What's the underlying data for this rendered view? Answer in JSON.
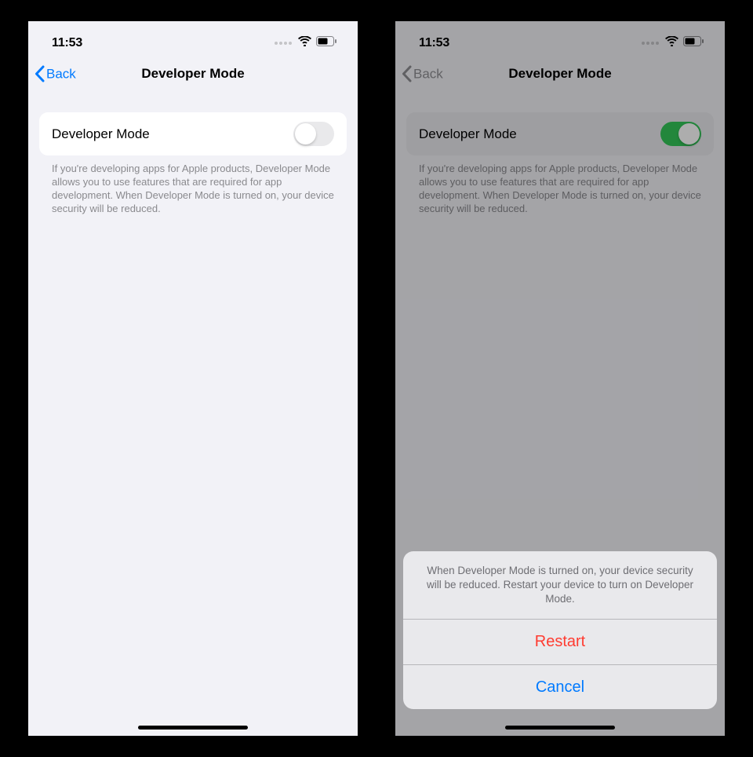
{
  "status": {
    "time": "11:53"
  },
  "screens": {
    "left": {
      "back": "Back",
      "title": "Developer Mode",
      "row_label": "Developer Mode",
      "toggle_on": false,
      "desc": "If you're developing apps for Apple products, Developer Mode allows you to use features that are required for app development. When Developer Mode is turned on, your device security will be reduced."
    },
    "right": {
      "back": "Back",
      "title": "Developer Mode",
      "row_label": "Developer Mode",
      "toggle_on": true,
      "desc": "If you're developing apps for Apple products, Developer Mode allows you to use features that are required for app development. When Developer Mode is turned on, your device security will be reduced.",
      "sheet": {
        "message": "When Developer Mode is turned on, your device security will be reduced. Restart your device to turn on Developer Mode.",
        "restart": "Restart",
        "cancel": "Cancel"
      }
    }
  }
}
